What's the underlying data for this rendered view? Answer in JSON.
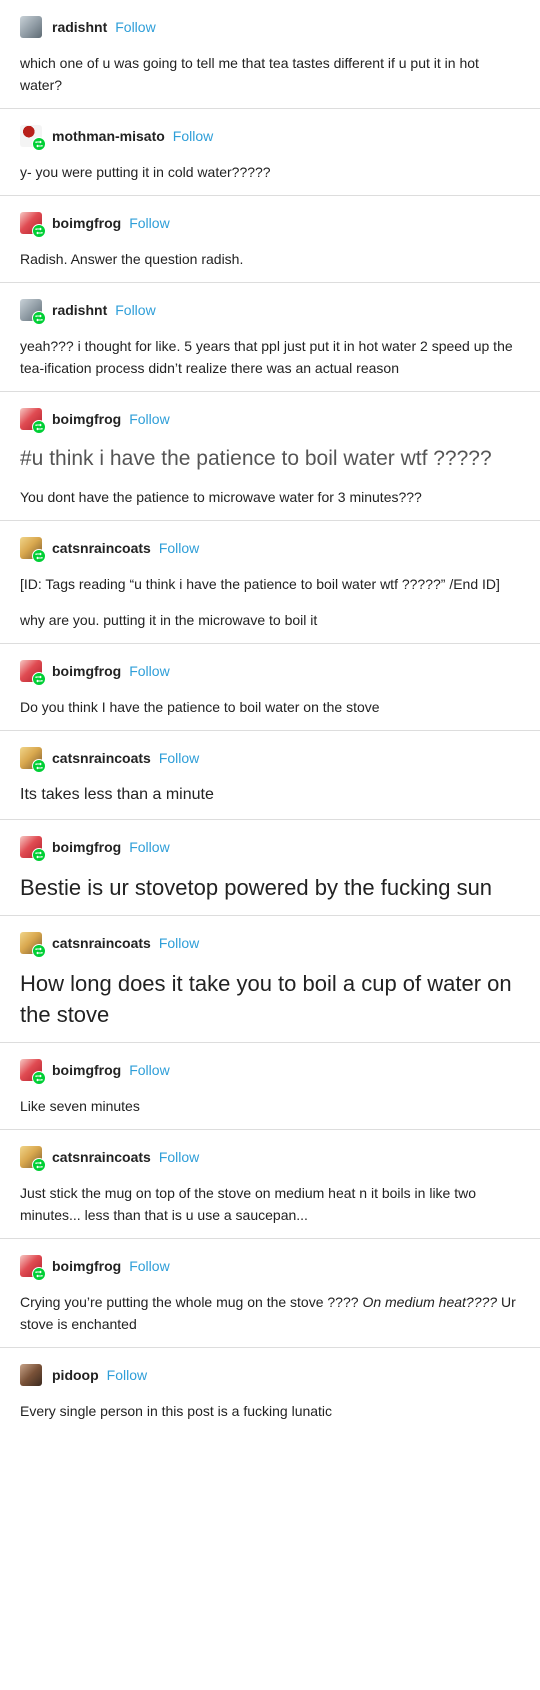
{
  "follow_label": "Follow",
  "posts": [
    {
      "username": "radishnt",
      "avatar": "radishnt-avatar",
      "paragraphs": [
        "which one of u was going to tell me that tea tastes different if u put it in hot water?"
      ]
    },
    {
      "username": "mothman-misato",
      "avatar": "mothman-misato-avatar",
      "paragraphs": [
        "y- you were putting it in cold water?????"
      ]
    },
    {
      "username": "boimgfrog",
      "avatar": "boimgfrog-avatar",
      "paragraphs": [
        "Radish. Answer the question radish."
      ]
    },
    {
      "username": "radishnt",
      "avatar": "radishnt-avatar",
      "paragraphs": [
        "yeah??? i thought for like. 5 years that ppl just put it in hot water 2 speed up the tea-ification process didn’t realize there was an actual reason"
      ]
    },
    {
      "username": "boimgfrog",
      "avatar": "boimgfrog-avatar",
      "tags": "#u think i have the patience to boil water wtf ?????",
      "paragraphs": [
        "You dont have the patience to microwave water for 3 minutes???"
      ]
    },
    {
      "username": "catsnraincoats",
      "avatar": "catsnraincoats-avatar",
      "paragraphs": [
        "[ID: Tags reading “u think i have the patience to boil water wtf ?????” /End ID]",
        "why are you. putting it in the microwave to boil it"
      ]
    },
    {
      "username": "boimgfrog",
      "avatar": "boimgfrog-avatar",
      "paragraphs": [
        "Do you think I have the patience to boil water on the stove"
      ]
    },
    {
      "username": "catsnraincoats",
      "avatar": "catsnraincoats-avatar",
      "paragraphs": [
        "Its takes less than a minute"
      ]
    },
    {
      "username": "boimgfrog",
      "avatar": "boimgfrog-avatar",
      "paragraphs": [
        "Bestie is ur stovetop powered by the fucking sun"
      ]
    },
    {
      "username": "catsnraincoats",
      "avatar": "catsnraincoats-avatar",
      "paragraphs": [
        "How long does it take you to boil a cup of water on the stove"
      ]
    },
    {
      "username": "boimgfrog",
      "avatar": "boimgfrog-avatar",
      "paragraphs": [
        "Like seven minutes"
      ]
    },
    {
      "username": "catsnraincoats",
      "avatar": "catsnraincoats-avatar",
      "paragraphs": [
        "Just stick the mug on top of the stove on medium heat n it boils in like two minutes... less than that is u use a saucepan..."
      ]
    },
    {
      "username": "boimgfrog",
      "avatar": "boimgfrog-avatar",
      "body_plain_1": "Crying you’re putting the whole mug on the stove ???? ",
      "body_italic": "On medium heat????",
      "body_plain_2": " Ur stove is enchanted"
    },
    {
      "username": "pidoop",
      "avatar": "pidoop-avatar",
      "paragraphs": [
        "Every single person in this post is a fucking lunatic"
      ]
    }
  ]
}
